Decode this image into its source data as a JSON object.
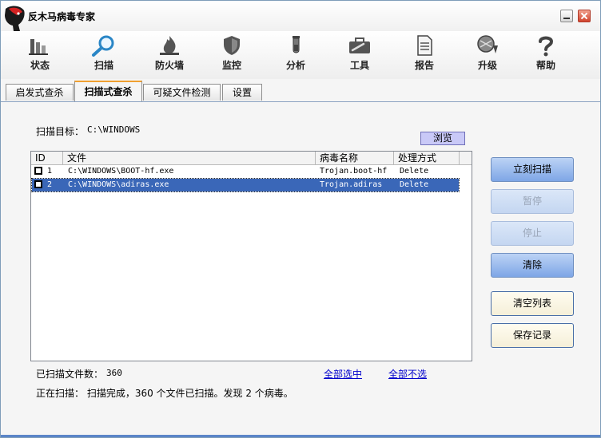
{
  "window": {
    "title": "反木马病毒专家"
  },
  "toolbar": {
    "items": [
      {
        "label": "状态",
        "icon": "bar-chart-icon"
      },
      {
        "label": "扫描",
        "icon": "magnifier-icon"
      },
      {
        "label": "防火墙",
        "icon": "firewall-flame-icon"
      },
      {
        "label": "监控",
        "icon": "shield-icon"
      },
      {
        "label": "分析",
        "icon": "test-tube-icon"
      },
      {
        "label": "工具",
        "icon": "toolbox-icon"
      },
      {
        "label": "报告",
        "icon": "document-icon"
      },
      {
        "label": "升级",
        "icon": "update-globe-icon"
      },
      {
        "label": "帮助",
        "icon": "help-question-icon"
      }
    ]
  },
  "tabs": [
    {
      "label": "启发式查杀",
      "active": false
    },
    {
      "label": "扫描式查杀",
      "active": true
    },
    {
      "label": "可疑文件检测",
      "active": false
    },
    {
      "label": "设置",
      "active": false
    }
  ],
  "scan": {
    "target_label": "扫描目标：",
    "target_value": "C:\\WINDOWS",
    "browse_label": "浏览"
  },
  "table": {
    "columns": [
      "ID",
      "文件",
      "病毒名称",
      "处理方式"
    ],
    "rows": [
      {
        "id": "1",
        "file": "C:\\WINDOWS\\BOOT-hf.exe",
        "virus": "Trojan.boot-hf",
        "action": "Delete",
        "selected": false
      },
      {
        "id": "2",
        "file": "C:\\WINDOWS\\adiras.exe",
        "virus": "Trojan.adiras",
        "action": "Delete",
        "selected": true
      }
    ]
  },
  "stats": {
    "scanned_label": "已扫描文件数：",
    "scanned_value": "360",
    "select_all": "全部选中",
    "deselect_all": "全部不选",
    "status": "正在扫描： 扫描完成，360 个文件已扫描。发现 2 个病毒。"
  },
  "buttons": {
    "scan_now": "立刻扫描",
    "pause": "暂停",
    "stop": "停止",
    "clean": "清除",
    "clear_list": "清空列表",
    "save_log": "保存记录"
  },
  "colors": {
    "selection": "#3a67b8",
    "button_blue": "#7ea6e6",
    "browse": "#c9c9f7",
    "link": "#0000cc"
  }
}
